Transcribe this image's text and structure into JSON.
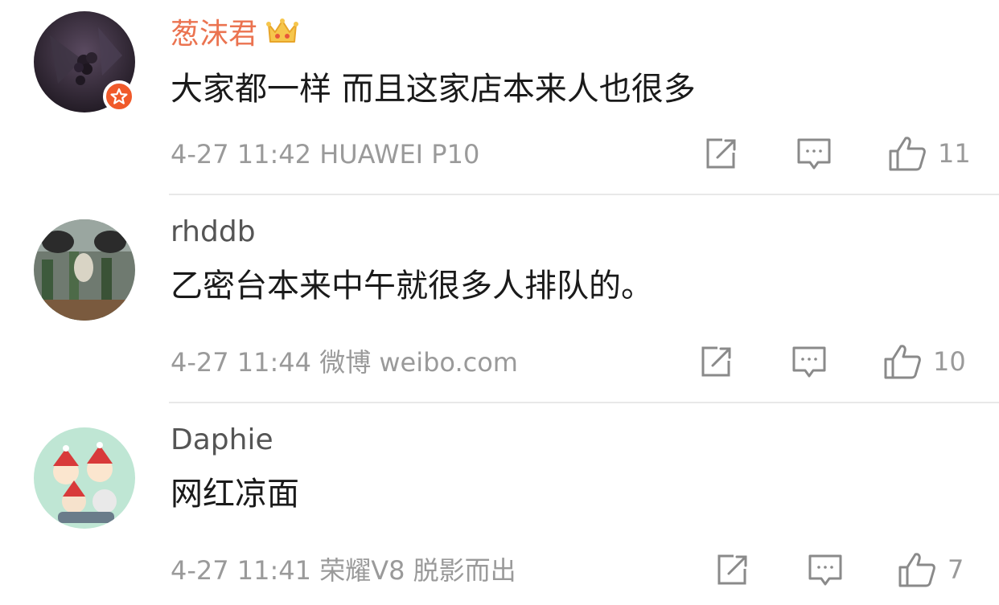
{
  "comments": [
    {
      "username": "葱沫君",
      "vip": true,
      "text": "大家都一样 而且这家店本来人也很多",
      "meta": "4-27 11:42  HUAWEI P10",
      "likes": "11"
    },
    {
      "username": "rhddb",
      "vip": false,
      "text": "乙密台本来中午就很多人排队的。",
      "meta": "4-27 11:44  微博 weibo.com",
      "likes": "10"
    },
    {
      "username": "Daphie",
      "vip": false,
      "text": "网红凉面",
      "meta": "4-27 11:41  荣耀V8 脱影而出",
      "likes": "7"
    }
  ],
  "icons": {
    "repost": "share-icon",
    "comment": "comment-icon",
    "like": "thumbs-up-icon",
    "vip": "vip-star-icon",
    "crown": "crown-icon"
  },
  "colors": {
    "vip_name": "#eb7350",
    "meta_text": "#9a9a9a",
    "badge": "#f05a2a"
  }
}
